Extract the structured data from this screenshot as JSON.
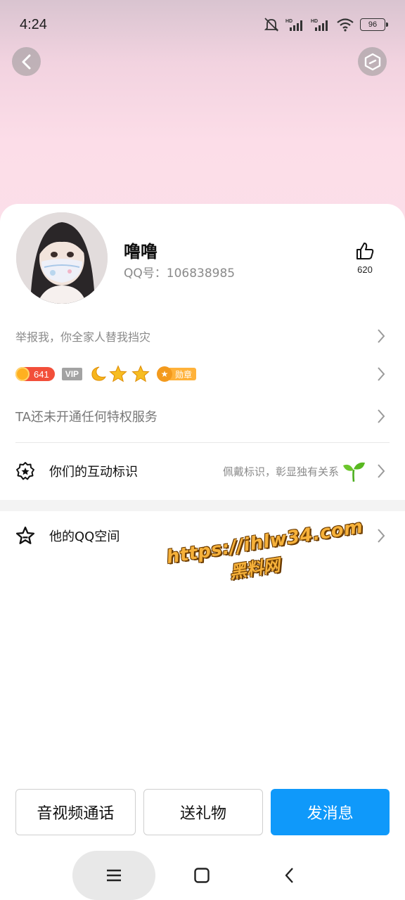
{
  "status_bar": {
    "time": "4:24",
    "battery": "96",
    "icons": [
      "mute-bell-icon",
      "hd-signal-icon",
      "hd-signal-icon",
      "wifi-icon",
      "battery-icon"
    ]
  },
  "header": {
    "back_icon": "back-arrow-icon",
    "more_icon": "settings-hexagon-icon"
  },
  "profile": {
    "nickname": "噜噜",
    "qq_label": "QQ号：106838985",
    "likes": "620",
    "signature": "举报我，你全家人替我挡灾"
  },
  "badges": {
    "coin_value": "641",
    "vip": "VIP",
    "medal_label": "勋章",
    "icons": [
      "moon-icon",
      "star-icon",
      "star-icon"
    ]
  },
  "privilege_text": "TA还未开通任何特权服务",
  "interaction": {
    "label": "你们的互动标识",
    "hint": "佩戴标识，彰显独有关系"
  },
  "space": {
    "label": "他的QQ空间"
  },
  "watermark": {
    "url": "https://ihlw34.com",
    "name": "黑料网"
  },
  "actions": {
    "call": "音视频通话",
    "gift": "送礼物",
    "message": "发消息"
  },
  "colors": {
    "primary": "#0f99fa",
    "hero_pink": "#fbdfe9",
    "coin_red": "#f24f3a",
    "medal_orange": "#f39a1d"
  }
}
